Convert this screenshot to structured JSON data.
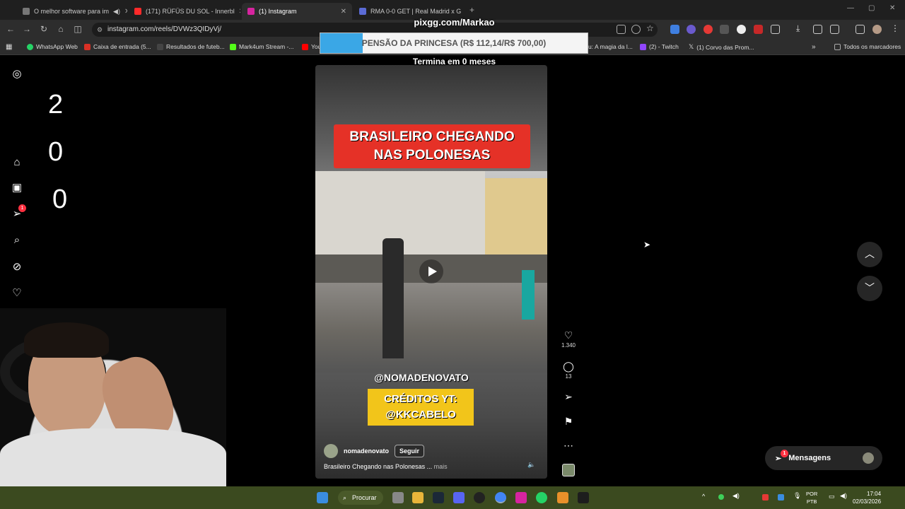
{
  "tabs": [
    {
      "title": "O melhor software para im",
      "color": "#777777",
      "active": false
    },
    {
      "title": "(171) RÜFÜS DU SOL - Innerbl",
      "color": "#ff2a2a",
      "active": false
    },
    {
      "title": "(1) Instagram",
      "color": "#d6249f",
      "active": true
    },
    {
      "title": "RMA 0-0 GET | Real Madrid x G",
      "color": "#5b6bd5",
      "active": false
    }
  ],
  "address": {
    "url": "instagram.com/reels/DVWz3QIDyVj/"
  },
  "bookmarks": [
    {
      "label": "WhatsApp Web",
      "color": "#25d366"
    },
    {
      "label": "Caixa de entrada (5...",
      "color": "#d93025"
    },
    {
      "label": "Resultados de futeb...",
      "color": "#444444"
    },
    {
      "label": "Mark4um Stream -...",
      "color": "#53fc18"
    },
    {
      "label": "You",
      "color": "#ff0000"
    },
    {
      "label": "u: A magia da l...",
      "color": "#888888"
    },
    {
      "label": "(2) - Twitch",
      "color": "#9146ff"
    },
    {
      "label": "(1) Corvo das Prom...",
      "color": "#ffffff"
    },
    {
      "label": "Todos os marcadores",
      "color": "#aaaaaa"
    }
  ],
  "overlay": {
    "url": "pixgg.com/Markao",
    "goal_text": "PENSÃO DA PRINCESA (R$ 112,14/R$ 700,00)",
    "progress": 0.16,
    "subtitle": "Termina em 0 meses"
  },
  "counters": [
    "2",
    "0",
    "0"
  ],
  "sidebar": {
    "notification_badge": "1",
    "icons": [
      "instagram-icon",
      "home-icon",
      "reels-icon",
      "direct-icon",
      "search-icon",
      "explore-icon",
      "heart-icon",
      "create-icon",
      "profile-icon"
    ]
  },
  "reel": {
    "title_line1": "BRASILEIRO CHEGANDO",
    "title_line2": "NAS POLONESAS",
    "handle_overlay": "@NOMADENOVATO",
    "credit_line1": "CRÉDITOS YT:",
    "credit_line2": "@KKCABELO",
    "author": "nomadenovato",
    "follow_label": "Seguir",
    "caption": "Brasileiro Chegando nas Polonesas ...",
    "more_label": "mais",
    "likes": "1.340",
    "comments": "13"
  },
  "messages": {
    "label": "Mensagens",
    "badge": "1"
  },
  "taskbar": {
    "search_label": "Procurar",
    "lang_line1": "POR",
    "lang_line2": "PTB",
    "time": "17:04",
    "date": "02/03/2026"
  }
}
